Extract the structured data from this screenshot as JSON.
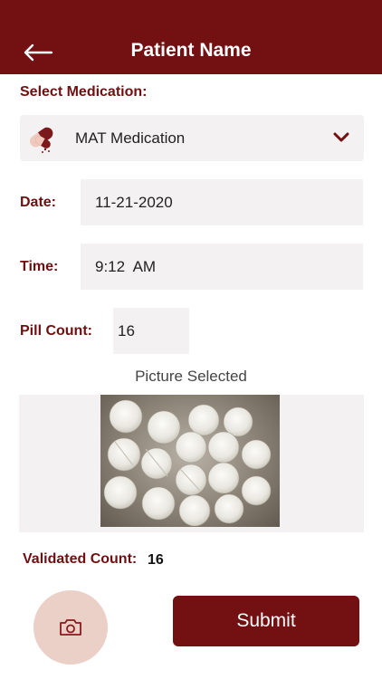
{
  "header": {
    "title": "Patient Name",
    "back_icon": "arrow-left-icon",
    "color": "#731011"
  },
  "medication": {
    "label": "Select Medication:",
    "selected": "MAT Medication",
    "icon": "pill-capsule-icon",
    "dropdown_icon": "chevron-down-icon"
  },
  "date": {
    "label": "Date:",
    "value": "11-21-2020"
  },
  "time": {
    "label": "Time:",
    "value": "9:12  AM"
  },
  "pill_count": {
    "label": "Pill Count:",
    "value": "16"
  },
  "picture": {
    "caption": "Picture Selected"
  },
  "validated": {
    "label": "Validated Count:",
    "value": "16"
  },
  "actions": {
    "camera_icon": "camera-icon",
    "submit_label": "Submit"
  }
}
